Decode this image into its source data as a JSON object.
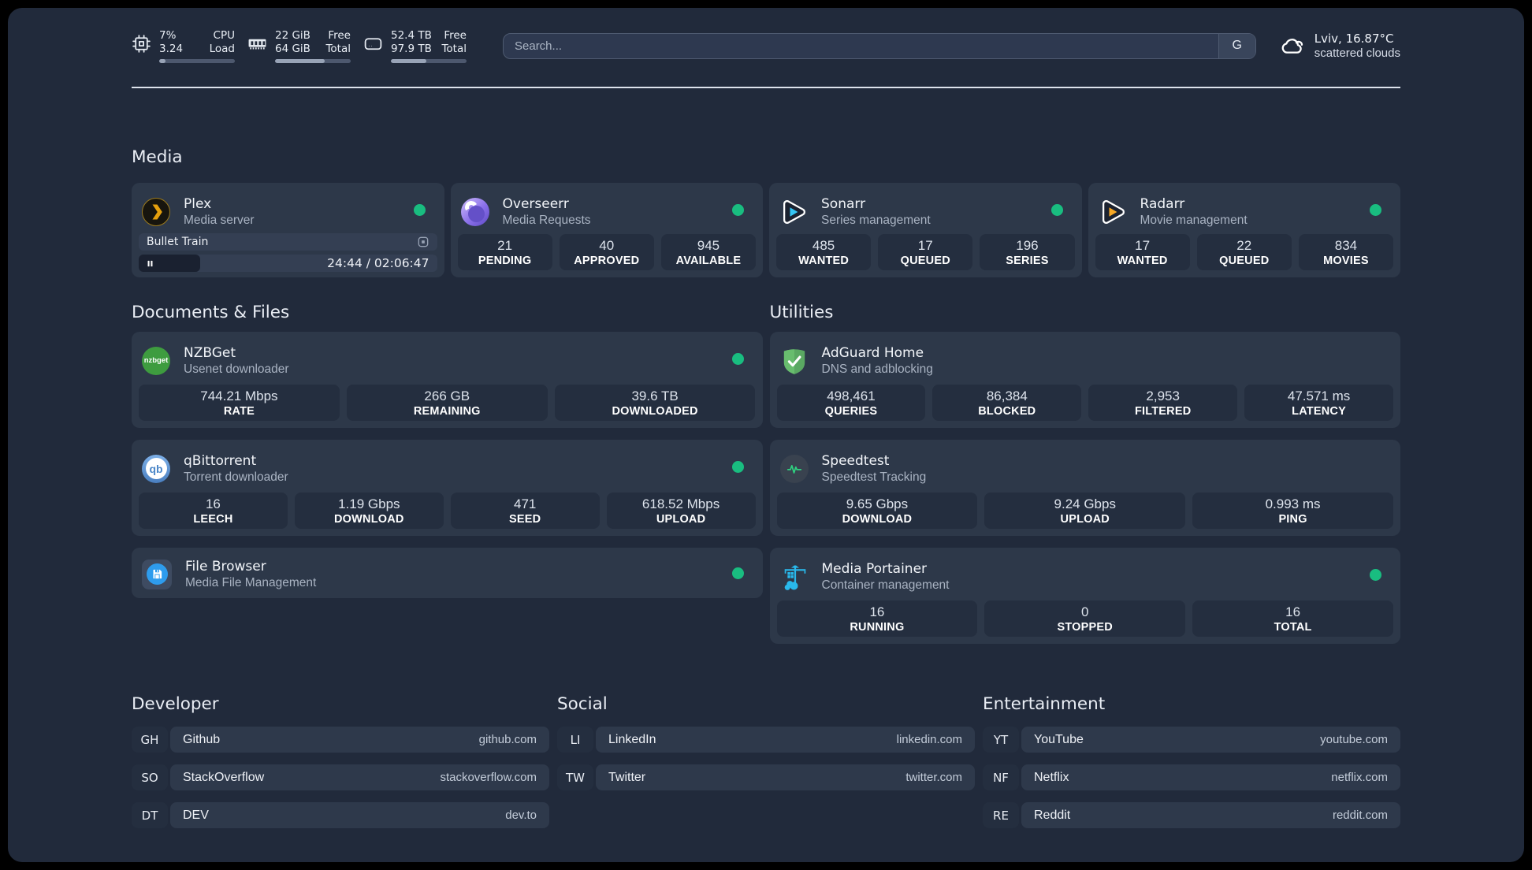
{
  "header": {
    "resources": [
      {
        "icon": "cpu",
        "top_left": "7%",
        "bottom_left": "3.24",
        "top_right": "CPU",
        "bottom_right": "Load",
        "progress": "8%"
      },
      {
        "icon": "memory",
        "top_left": "22 GiB",
        "bottom_left": "64 GiB",
        "top_right": "Free",
        "bottom_right": "Total",
        "progress": "66%"
      },
      {
        "icon": "disk",
        "top_left": "52.4 TB",
        "bottom_left": "97.9 TB",
        "top_right": "Free",
        "bottom_right": "Total",
        "progress": "47%"
      }
    ],
    "search_placeholder": "Search...",
    "search_button": "G",
    "weather": {
      "location_temp": "Lviv, 16.87°C",
      "condition": "scattered clouds"
    }
  },
  "media": {
    "heading": "Media",
    "plex": {
      "title": "Plex",
      "subtitle": "Media server",
      "now_playing": {
        "title": "Bullet Train",
        "time": "24:44 / 02:06:47",
        "progress": "20.6%"
      }
    },
    "overseerr": {
      "title": "Overseerr",
      "subtitle": "Media Requests",
      "stats": [
        {
          "value": "21",
          "label": "PENDING"
        },
        {
          "value": "40",
          "label": "APPROVED"
        },
        {
          "value": "945",
          "label": "AVAILABLE"
        }
      ]
    },
    "sonarr": {
      "title": "Sonarr",
      "subtitle": "Series management",
      "stats": [
        {
          "value": "485",
          "label": "WANTED"
        },
        {
          "value": "17",
          "label": "QUEUED"
        },
        {
          "value": "196",
          "label": "SERIES"
        }
      ]
    },
    "radarr": {
      "title": "Radarr",
      "subtitle": "Movie management",
      "stats": [
        {
          "value": "17",
          "label": "WANTED"
        },
        {
          "value": "22",
          "label": "QUEUED"
        },
        {
          "value": "834",
          "label": "MOVIES"
        }
      ]
    }
  },
  "documents": {
    "heading": "Documents & Files",
    "nzbget": {
      "title": "NZBGet",
      "subtitle": "Usenet downloader",
      "logo_text": "nzbget",
      "stats": [
        {
          "value": "744.21 Mbps",
          "label": "RATE"
        },
        {
          "value": "266 GB",
          "label": "REMAINING"
        },
        {
          "value": "39.6 TB",
          "label": "DOWNLOADED"
        }
      ]
    },
    "qbittorrent": {
      "title": "qBittorrent",
      "subtitle": "Torrent downloader",
      "logo_text": "qb",
      "stats": [
        {
          "value": "16",
          "label": "LEECH"
        },
        {
          "value": "1.19 Gbps",
          "label": "DOWNLOAD"
        },
        {
          "value": "471",
          "label": "SEED"
        },
        {
          "value": "618.52 Mbps",
          "label": "UPLOAD"
        }
      ]
    },
    "filebrowser": {
      "title": "File Browser",
      "subtitle": "Media File Management"
    }
  },
  "utilities": {
    "heading": "Utilities",
    "adguard": {
      "title": "AdGuard Home",
      "subtitle": "DNS and adblocking",
      "stats": [
        {
          "value": "498,461",
          "label": "QUERIES"
        },
        {
          "value": "86,384",
          "label": "BLOCKED"
        },
        {
          "value": "2,953",
          "label": "FILTERED"
        },
        {
          "value": "47.571 ms",
          "label": "LATENCY"
        }
      ]
    },
    "speedtest": {
      "title": "Speedtest",
      "subtitle": "Speedtest Tracking",
      "stats": [
        {
          "value": "9.65 Gbps",
          "label": "DOWNLOAD"
        },
        {
          "value": "9.24 Gbps",
          "label": "UPLOAD"
        },
        {
          "value": "0.993 ms",
          "label": "PING"
        }
      ]
    },
    "portainer": {
      "title": "Media Portainer",
      "subtitle": "Container management",
      "stats": [
        {
          "value": "16",
          "label": "RUNNING"
        },
        {
          "value": "0",
          "label": "STOPPED"
        },
        {
          "value": "16",
          "label": "TOTAL"
        }
      ]
    }
  },
  "developer": {
    "heading": "Developer",
    "links": [
      {
        "abbr": "GH",
        "name": "Github",
        "url": "github.com"
      },
      {
        "abbr": "SO",
        "name": "StackOverflow",
        "url": "stackoverflow.com"
      },
      {
        "abbr": "DT",
        "name": "DEV",
        "url": "dev.to"
      }
    ]
  },
  "social": {
    "heading": "Social",
    "links": [
      {
        "abbr": "LI",
        "name": "LinkedIn",
        "url": "linkedin.com"
      },
      {
        "abbr": "TW",
        "name": "Twitter",
        "url": "twitter.com"
      }
    ]
  },
  "entertainment": {
    "heading": "Entertainment",
    "links": [
      {
        "abbr": "YT",
        "name": "YouTube",
        "url": "youtube.com"
      },
      {
        "abbr": "NF",
        "name": "Netflix",
        "url": "netflix.com"
      },
      {
        "abbr": "RE",
        "name": "Reddit",
        "url": "reddit.com"
      }
    ]
  },
  "colors": {
    "status_online": "#19bd80",
    "accent_green": "#2fd180",
    "portainer_blue": "#29b9ec"
  }
}
